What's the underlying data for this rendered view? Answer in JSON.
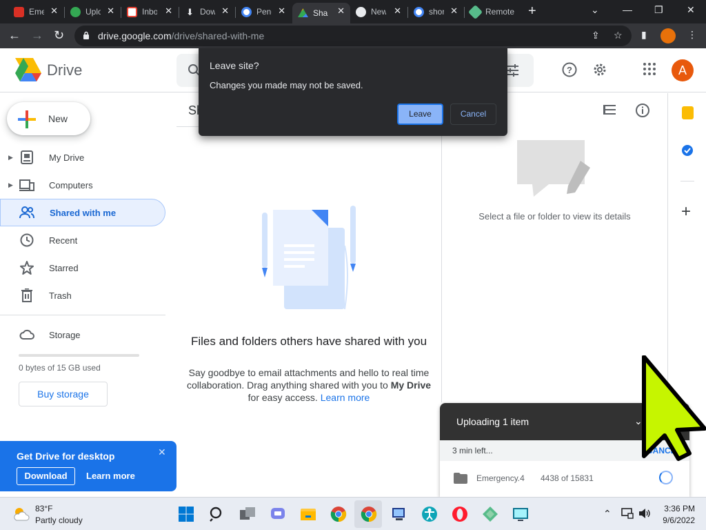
{
  "browser": {
    "tabs": [
      {
        "title": "Emergency",
        "favicon": "pdf-icon",
        "color": "#d93025"
      },
      {
        "title": "Upload",
        "favicon": "cloud-icon",
        "color": "#34a853"
      },
      {
        "title": "Inbox",
        "favicon": "gmail-icon",
        "color": "#ea4335"
      },
      {
        "title": "Downloads",
        "favicon": "download-icon",
        "color": "#e8eaed"
      },
      {
        "title": "Pending",
        "favicon": "google-icon",
        "color": "#4285f4"
      },
      {
        "title": "Shared",
        "favicon": "drive-icon",
        "color": "#fbbc04"
      },
      {
        "title": "New Tab",
        "favicon": "chrome-icon",
        "color": "#e8eaed"
      },
      {
        "title": "shortcuts",
        "favicon": "google-icon",
        "color": "#4285f4"
      },
      {
        "title": "Remote",
        "favicon": "remote-icon",
        "color": "#57bb8a"
      }
    ],
    "url_host": "drive.google.com",
    "url_path": "/drive/shared-with-me"
  },
  "drive": {
    "logo_text": "Drive",
    "avatar_letter": "A",
    "new_label": "New",
    "nav": [
      {
        "label": "My Drive",
        "icon": "my-drive-icon"
      },
      {
        "label": "Computers",
        "icon": "computers-icon"
      },
      {
        "label": "Shared with me",
        "icon": "shared-icon"
      },
      {
        "label": "Recent",
        "icon": "clock-icon"
      },
      {
        "label": "Starred",
        "icon": "star-icon"
      },
      {
        "label": "Trash",
        "icon": "trash-icon"
      }
    ],
    "storage_label": "Storage",
    "storage_usage": "0 bytes of 15 GB used",
    "buy_storage": "Buy storage",
    "promo": {
      "title": "Get Drive for desktop",
      "download": "Download",
      "learn_more": "Learn more"
    },
    "main_title": "Sh",
    "empty": {
      "title": "Files and folders others have shared with you",
      "body_1": "Say goodbye to email attachments and hello to real time collaboration. Drag anything shared with you to ",
      "body_bold": "My Drive",
      "body_2": " for easy access. ",
      "link": "Learn more"
    },
    "details_text": "Select a file or folder to view its details"
  },
  "dialog": {
    "title": "Leave site?",
    "message": "Changes you made may not be saved.",
    "leave": "Leave",
    "cancel": "Cancel"
  },
  "upload": {
    "title": "Uploading 1 item",
    "eta": "3 min left...",
    "cancel": "CANCEL",
    "file_name": "Emergency.4",
    "progress_text": "4438 of 15831"
  },
  "taskbar": {
    "temp": "83°F",
    "condition": "Partly cloudy",
    "time": "3:36 PM",
    "date": "9/6/2022"
  },
  "colors": {
    "accent": "#1a73e8",
    "dialog_bg": "#292a2d",
    "cursor": "#c6f500"
  }
}
